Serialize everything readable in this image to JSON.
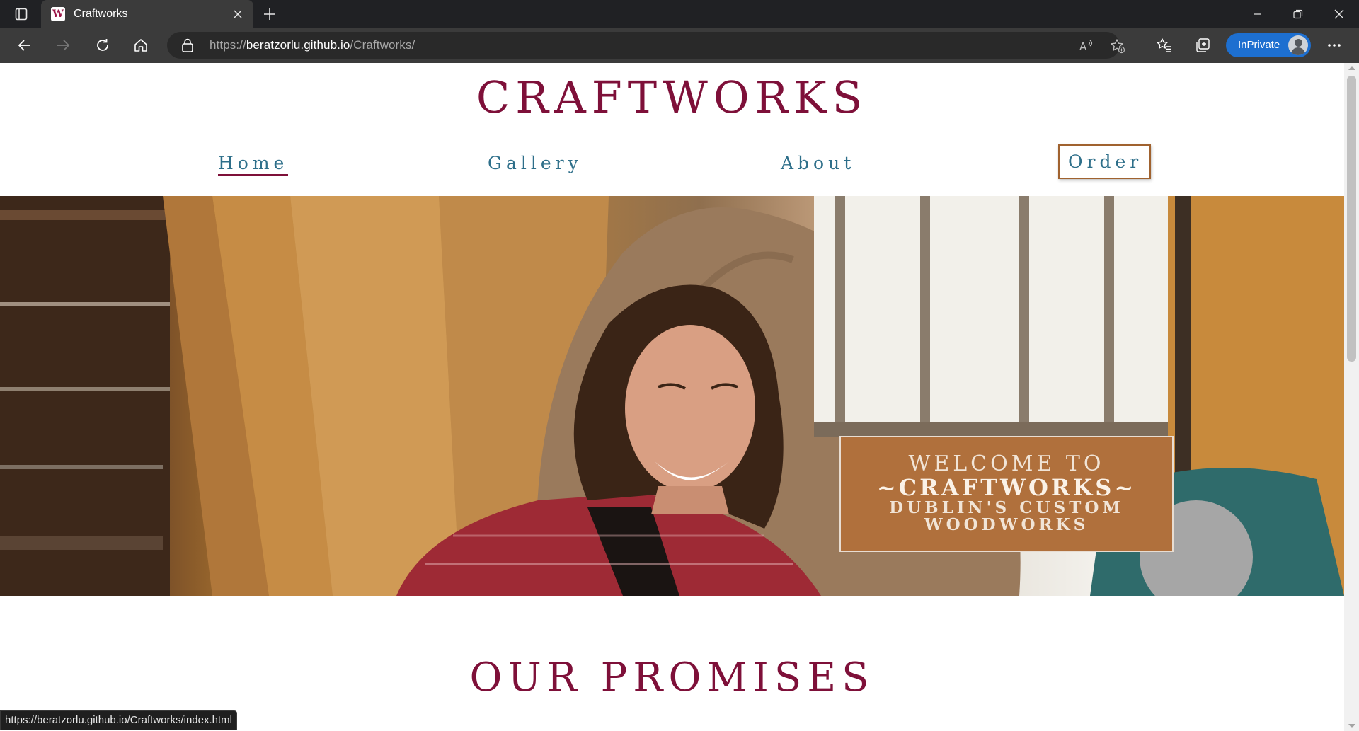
{
  "browser": {
    "tab_title": "Craftworks",
    "url_scheme": "https://",
    "url_host": "beratzorlu.github.io",
    "url_path": "/Craftworks/",
    "inprivate_label": "InPrivate",
    "status_url": "https://beratzorlu.github.io/Craftworks/index.html"
  },
  "site": {
    "title": "CRAFTWORKS",
    "nav": [
      {
        "label": "Home",
        "active": true
      },
      {
        "label": "Gallery"
      },
      {
        "label": "About"
      },
      {
        "label": "Order"
      }
    ],
    "welcome": {
      "line1": "WELCOME TO",
      "line2": "~CRAFTWORKS~",
      "line3": "DUBLIN'S CUSTOM",
      "line4": "WOODWORKS"
    },
    "section_heading": "OUR PROMISES"
  },
  "colors": {
    "brand": "#7e1039",
    "nav_text": "#2e6f8a",
    "welcome_box": "#b0703c",
    "accent_browser": "#1d6fd0"
  },
  "icons": [
    "tab-actions-icon",
    "favicon",
    "close-icon",
    "new-tab-icon",
    "minimize-icon",
    "restore-icon",
    "window-close-icon",
    "back-icon",
    "forward-icon",
    "refresh-icon",
    "home-icon",
    "lock-icon",
    "read-aloud-icon",
    "add-favorite-icon",
    "favorites-icon",
    "collections-icon",
    "more-icon"
  ]
}
